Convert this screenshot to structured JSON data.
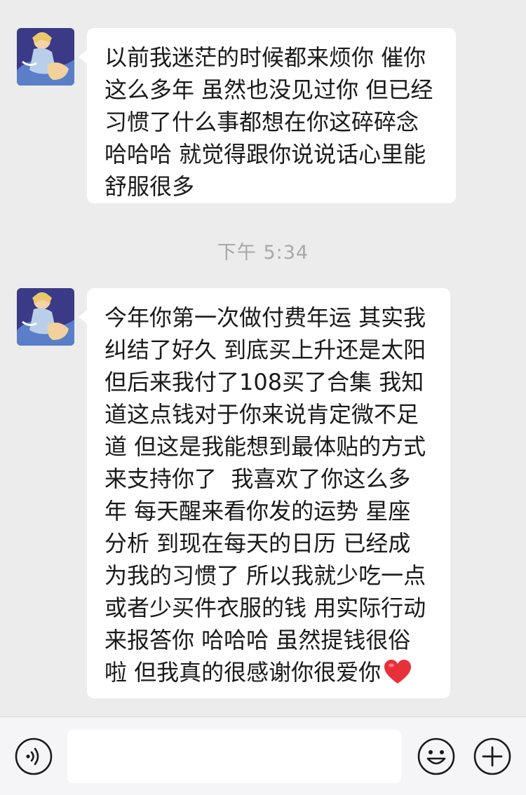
{
  "messages": [
    {
      "text": "以前我迷茫的时候都来烦你 催你 这么多年 虽然也没见过你 但已经习惯了什么事都想在你这碎碎念 哈哈哈 就觉得跟你说说话心里能舒服很多"
    },
    {
      "text": "今年你第一次做付费年运 其实我纠结了好久 到底买上升还是太阳 但后来我付了108买了合集 我知道这点钱对于你来说肯定微不足道 但这是我能想到最体贴的方式来支持你了  我喜欢了你这么多年 每天醒来看你发的运势 星座分析 到现在每天的日历 已经成为我的习惯了 所以我就少吃一点或者少买件衣服的钱 用实际行动来报答你 哈哈哈 虽然提钱很俗啦 但我真的很感谢你很爱你",
      "trailing_icon": "red-heart-emoji"
    }
  ],
  "timestamp": "下午 5:34",
  "input_bar": {
    "input_value": "",
    "voice_icon": "voice-icon",
    "emoji_icon": "emoji-icon",
    "more_icon": "plus-icon"
  },
  "colors": {
    "background": "#ececec",
    "bubble": "#ffffff",
    "timestamp": "#a8a8a8",
    "heart": "#e8303a"
  }
}
